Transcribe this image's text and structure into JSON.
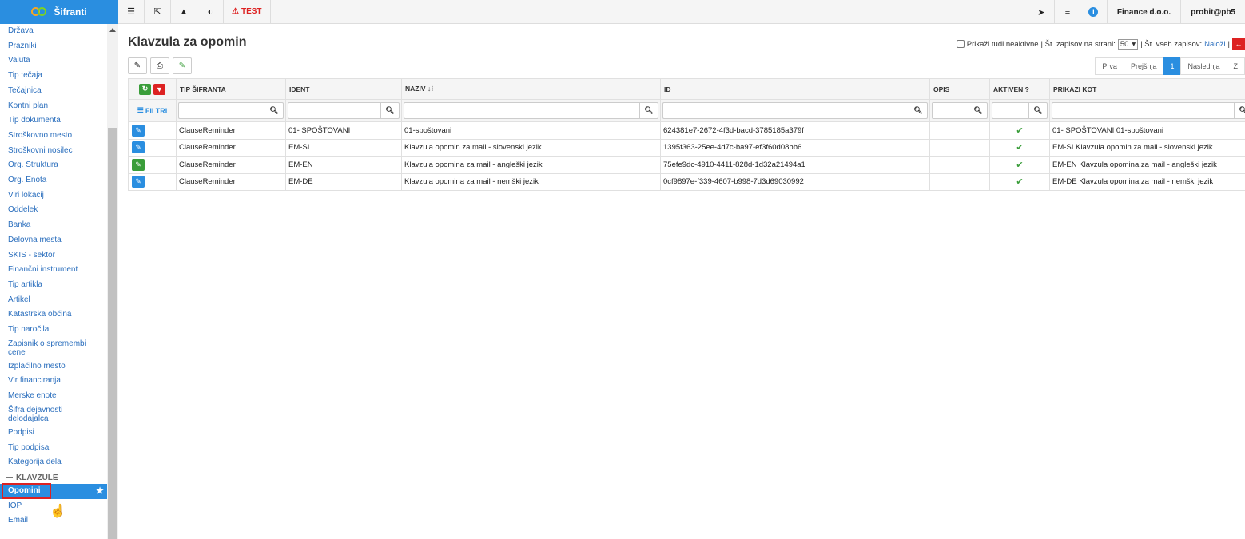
{
  "sidebar": {
    "brand": "Šifranti",
    "items": [
      {
        "label": "Država"
      },
      {
        "label": "Prazniki"
      },
      {
        "label": "Valuta"
      },
      {
        "label": "Tip tečaja"
      },
      {
        "label": "Tečajnica"
      },
      {
        "label": "Kontni plan"
      },
      {
        "label": "Tip dokumenta"
      },
      {
        "label": "Stroškovno mesto"
      },
      {
        "label": "Stroškovni nosilec"
      },
      {
        "label": "Org. Struktura"
      },
      {
        "label": "Org. Enota"
      },
      {
        "label": "Viri lokacij"
      },
      {
        "label": "Oddelek"
      },
      {
        "label": "Banka"
      },
      {
        "label": "Delovna mesta"
      },
      {
        "label": "SKIS - sektor"
      },
      {
        "label": "Finančni instrument"
      },
      {
        "label": "Tip artikla"
      },
      {
        "label": "Artikel"
      },
      {
        "label": "Katastrska občina"
      },
      {
        "label": "Tip naročila"
      },
      {
        "label": "Zapisnik o spremembi cene"
      },
      {
        "label": "Izplačilno mesto"
      },
      {
        "label": "Vir financiranja"
      },
      {
        "label": "Merske enote"
      },
      {
        "label": "Šifra dejavnosti delodajalca"
      },
      {
        "label": "Podpisi"
      },
      {
        "label": "Tip podpisa"
      },
      {
        "label": "Kategorija dela"
      }
    ],
    "group": "KLAVZULE",
    "group_items": [
      {
        "label": "Opomini"
      },
      {
        "label": "IOP"
      },
      {
        "label": "Email"
      }
    ]
  },
  "topbar": {
    "test_label": "TEST",
    "company": "Finance d.o.o.",
    "user": "probit@pb5"
  },
  "page": {
    "title": "Klavzula za opomin",
    "show_inactive": "Prikaži tudi neaktivne",
    "per_page_label": "| Št. zapisov na strani:",
    "per_page_value": "50",
    "total_label": "| Št. vseh zapisov:",
    "load_link": "Naloži",
    "sep": "|"
  },
  "pager": {
    "first": "Prva",
    "prev": "Prejšnja",
    "current": "1",
    "next": "Naslednja",
    "last": "Z"
  },
  "table": {
    "filter_label": "FILTRI",
    "columns": [
      "TIP ŠIFRANTA",
      "IDENT",
      "NAZIV",
      "ID",
      "OPIS",
      "AKTIVEN ?",
      "PRIKAZI KOT"
    ],
    "rows": [
      {
        "tip": "ClauseReminder",
        "ident": "01- SPOŠTOVANI",
        "naziv": "01-spoštovani",
        "id": "624381e7-2672-4f3d-bacd-3785185a379f",
        "opis": "",
        "prikazi": "01- SPOŠTOVANI 01-spoštovani"
      },
      {
        "tip": "ClauseReminder",
        "ident": "EM-SI",
        "naziv": "Klavzula opomin za mail - slovenski jezik",
        "id": "1395f363-25ee-4d7c-ba97-ef3f60d08bb6",
        "opis": "",
        "prikazi": "EM-SI Klavzula opomin za mail - slovenski jezik"
      },
      {
        "tip": "ClauseReminder",
        "ident": "EM-EN",
        "naziv": "Klavzula opomina za mail - angleški jezik",
        "id": "75efe9dc-4910-4411-828d-1d32a21494a1",
        "opis": "",
        "prikazi": "EM-EN Klavzula opomina za mail - angleški jezik"
      },
      {
        "tip": "ClauseReminder",
        "ident": "EM-DE",
        "naziv": "Klavzula opomina za mail - nemški jezik",
        "id": "0cf9897e-f339-4607-b998-7d3d69030992",
        "opis": "",
        "prikazi": "EM-DE Klavzula opomina za mail - nemški jezik"
      }
    ]
  },
  "colors": {
    "accent": "#2a8ee0",
    "danger": "#dd2222",
    "success": "#3a9d3a"
  },
  "icons": [
    "list-icon",
    "external-link-icon",
    "bag-icon",
    "contrast-icon",
    "warning-icon",
    "send-icon",
    "menu-icon",
    "info-icon",
    "wrench-icon",
    "print-icon",
    "pencil-icon",
    "refresh-icon",
    "filter-icon",
    "search-icon",
    "check-icon",
    "star-icon",
    "hand-cursor-icon"
  ]
}
